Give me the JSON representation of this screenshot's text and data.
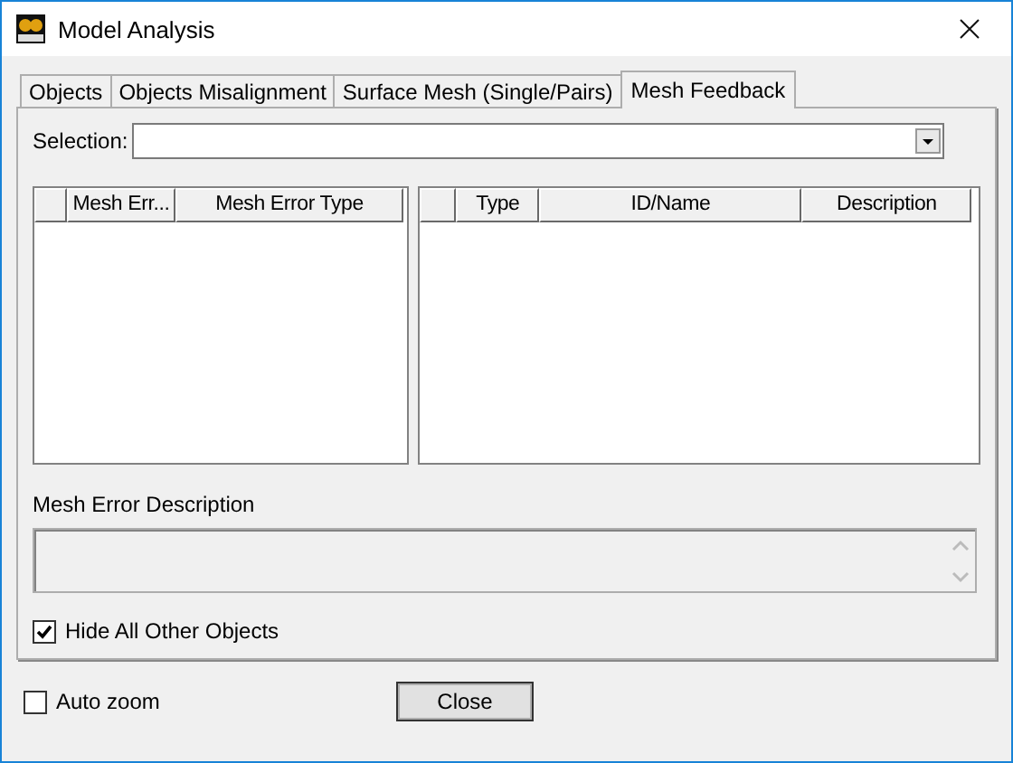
{
  "window": {
    "title": "Model Analysis"
  },
  "tabs": [
    {
      "label": "Objects",
      "selected": false
    },
    {
      "label": "Objects Misalignment",
      "selected": false
    },
    {
      "label": "Surface Mesh (Single/Pairs)",
      "selected": false
    },
    {
      "label": "Mesh Feedback",
      "selected": true
    }
  ],
  "selection": {
    "label": "Selection:"
  },
  "left_grid": {
    "columns": [
      "Mesh Err...",
      "Mesh Error Type"
    ]
  },
  "right_grid": {
    "columns": [
      "Type",
      "ID/Name",
      "Description"
    ]
  },
  "description": {
    "label": "Mesh Error Description"
  },
  "hide_others": {
    "label": "Hide All Other Objects",
    "checked": true
  },
  "auto_zoom": {
    "label": "Auto zoom",
    "checked": false
  },
  "close_button": "Close"
}
